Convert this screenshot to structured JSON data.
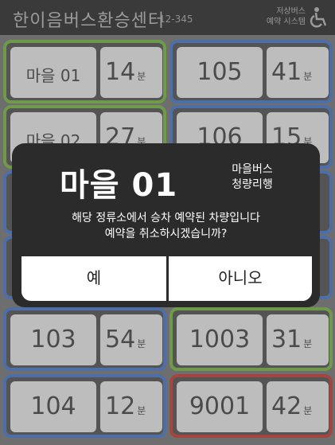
{
  "header": {
    "title": "한이음버스환승센터",
    "stop_code": "12-345",
    "reserve_line1": "저상버스",
    "reserve_line2": "예약 시스템"
  },
  "cards": [
    {
      "route": "마을 01",
      "minutes": "14",
      "color": "green"
    },
    {
      "route": "105",
      "minutes": "41",
      "color": "blue"
    },
    {
      "route": "마을 02",
      "minutes": "27",
      "color": "green"
    },
    {
      "route": "106",
      "minutes": "15",
      "color": "blue"
    },
    {
      "route": "103",
      "minutes": "54",
      "color": "blue"
    },
    {
      "route": "1003",
      "minutes": "31",
      "color": "green"
    },
    {
      "route": "104",
      "minutes": "12",
      "color": "blue"
    },
    {
      "route": "9001",
      "minutes": "42",
      "color": "red"
    }
  ],
  "minute_unit": "분",
  "modal": {
    "route": "마을 01",
    "bus_type_line1": "마을버스",
    "bus_type_line2": "청량리행",
    "message_line1": "해당 정류소에서 승차 예약된 차량입니다",
    "message_line2": "예약을 취소하시겠습니까?",
    "yes_label": "예",
    "no_label": "아니오"
  },
  "colors": {
    "green": "#6f9a4a",
    "blue": "#4e6ea8",
    "red": "#a3463f",
    "modal_bg": "#2b2b2b"
  }
}
